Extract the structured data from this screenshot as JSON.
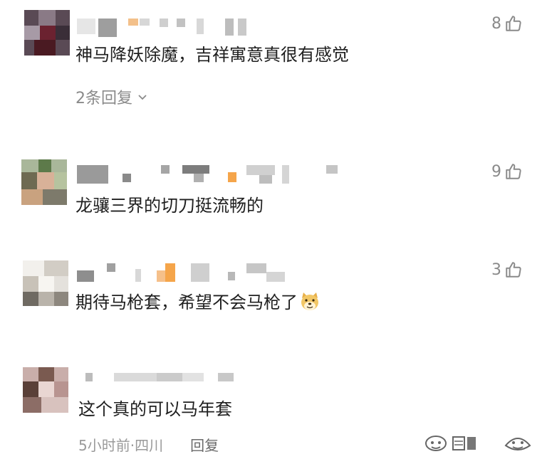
{
  "comments": [
    {
      "text": "神马降妖除魔，吉祥寓意真很有感觉",
      "likes": "8",
      "replies_label": "2条回复"
    },
    {
      "text": "龙骧三界的切刀挺流畅的",
      "likes": "9"
    },
    {
      "text": "期待马枪套，希望不会马枪了",
      "likes": "3",
      "emoji": "doge-emoji"
    },
    {
      "text": "这个真的可以马年套",
      "time": "5小时前",
      "location": "四川",
      "reply_label": "回复"
    }
  ],
  "icons": [
    "thumbs-up-icon",
    "chevron-down-icon",
    "doge-emoji-icon",
    "sticker-icon"
  ],
  "colors": {
    "text": "#1f1f1f",
    "secondary": "#8a8a8a",
    "accent": "#f5a54a"
  }
}
